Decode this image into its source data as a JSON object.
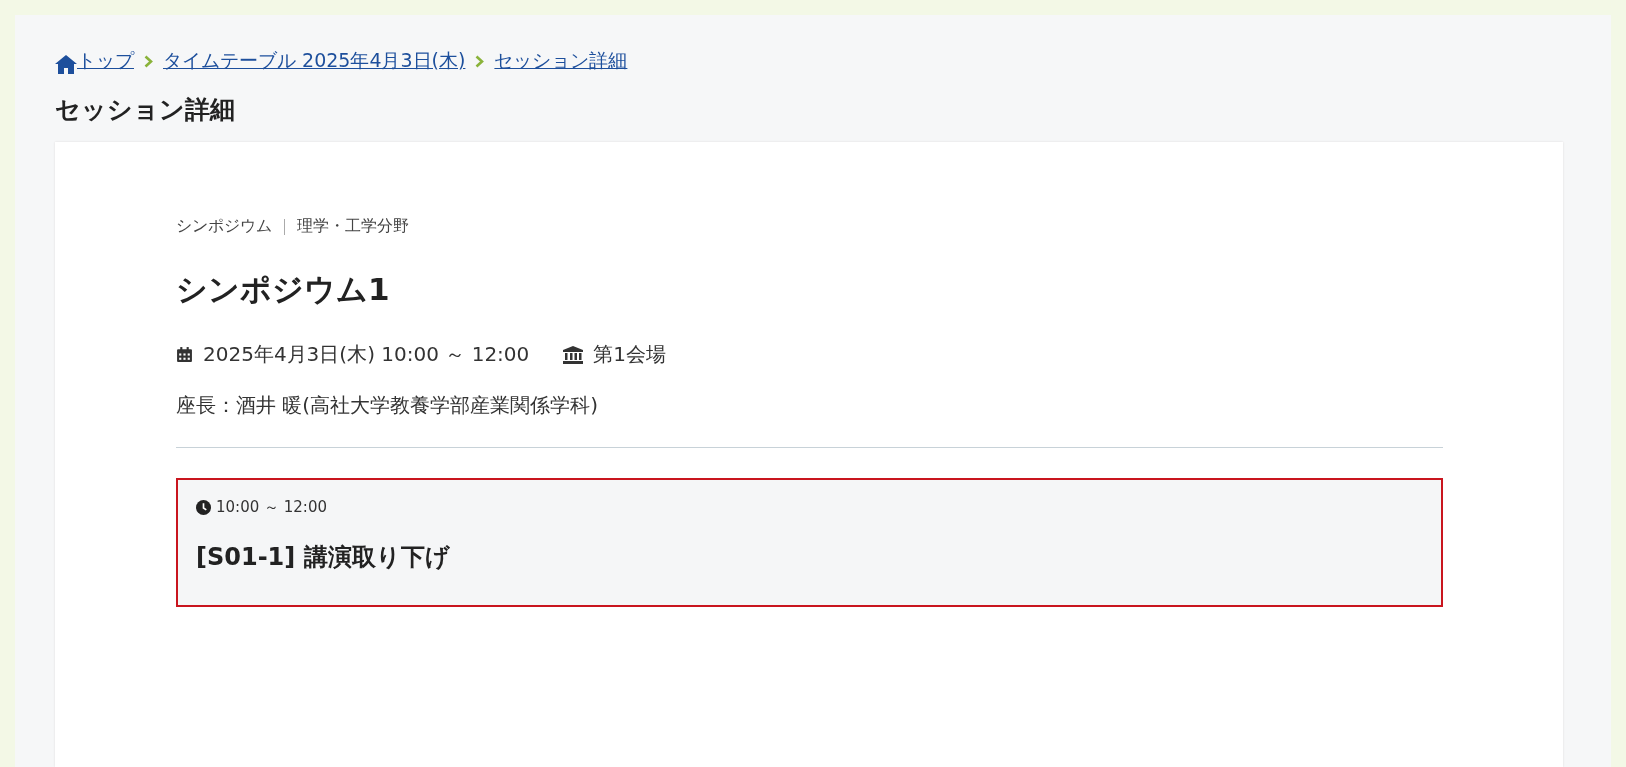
{
  "breadcrumbs": [
    {
      "label": "トップ",
      "kind": "home"
    },
    {
      "label": "タイムテーブル 2025年4月3日(木)",
      "kind": "link"
    },
    {
      "label": "セッション詳細",
      "kind": "link"
    }
  ],
  "page_title": "セッション詳細",
  "session": {
    "category": "シンポジウム",
    "field": "理学・工学分野",
    "title": "シンポジウム1",
    "datetime": "2025年4月3日(木) 10:00 ～ 12:00",
    "venue": "第1会場",
    "chair": "座長：酒井 暖(高社大学教養学部産業関係学科)"
  },
  "talks": [
    {
      "time": "10:00 ～ 12:00",
      "title": "[S01-1] 講演取り下げ",
      "withdrawn": true
    }
  ]
}
